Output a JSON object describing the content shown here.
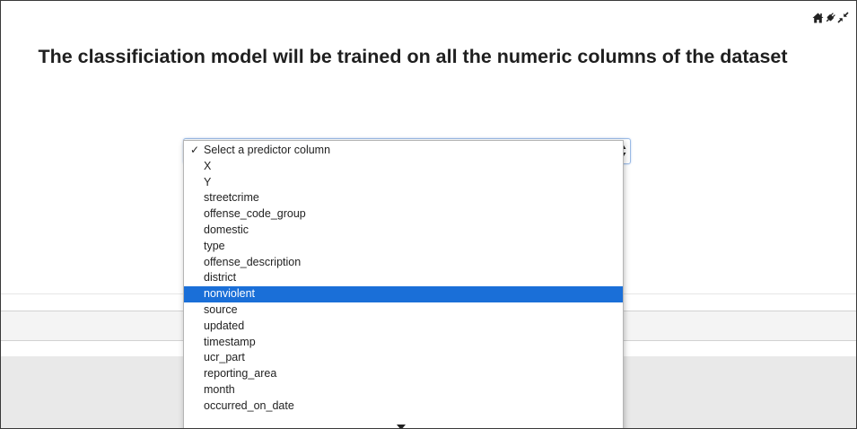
{
  "header": {
    "title": "The classificiation model will be trained on all the numeric columns of the dataset"
  },
  "toolbar": {
    "icons": [
      "home-icon",
      "plug-icon",
      "collapse-icon"
    ]
  },
  "predictor_select": {
    "placeholder": "Select a predictor column",
    "highlighted": "nonviolent",
    "options": [
      "Select a predictor column",
      "X",
      "Y",
      "streetcrime",
      "offense_code_group",
      "domestic",
      "type",
      "offense_description",
      "district",
      "nonviolent",
      "source",
      "updated",
      "timestamp",
      "ucr_part",
      "reporting_area",
      "month",
      "occurred_on_date"
    ]
  },
  "colors": {
    "highlight": "#1a6fd8",
    "title": "#1f1f1f",
    "focus_border": "#9bbbe6"
  }
}
